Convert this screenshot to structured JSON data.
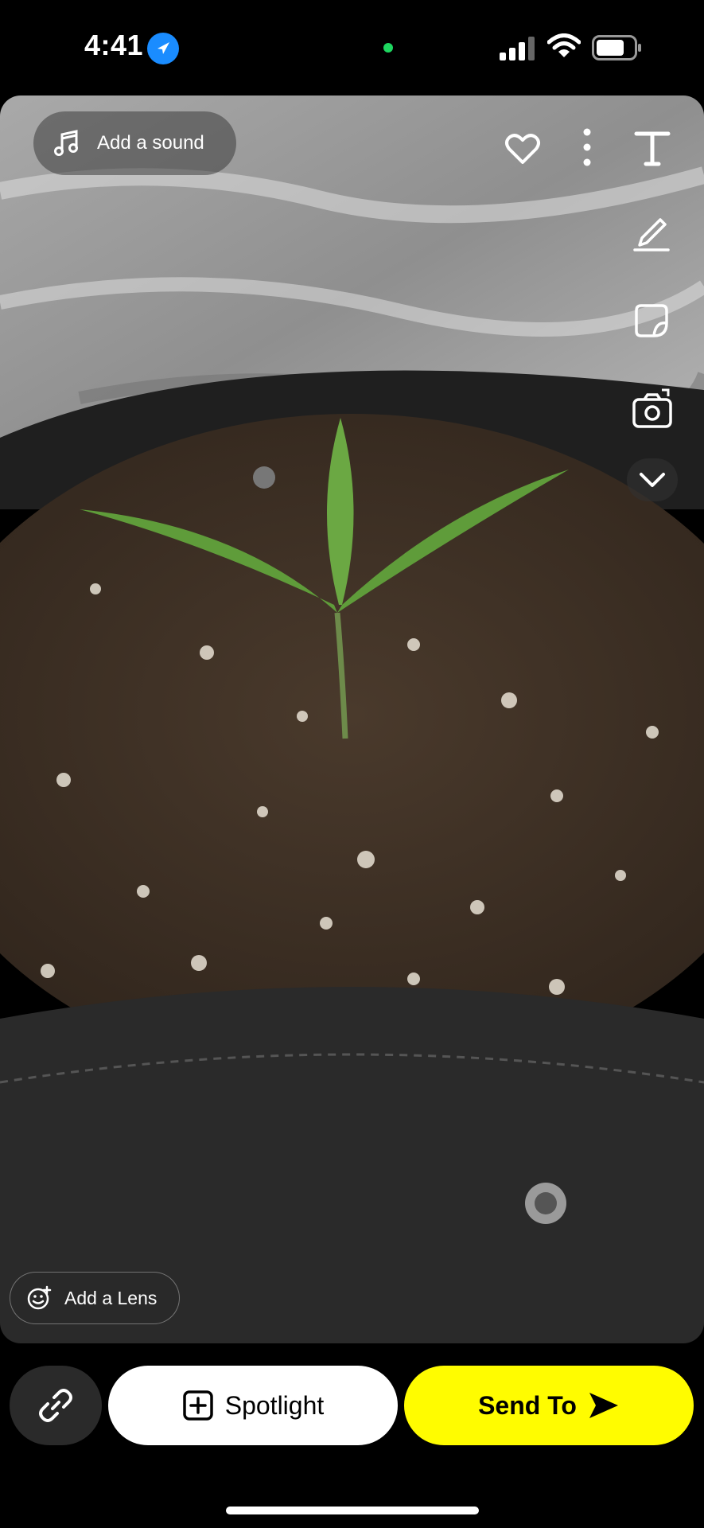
{
  "status_bar": {
    "time": "4:41"
  },
  "toolbar": {
    "add_sound_label": "Add a sound",
    "add_lens_label": "Add a Lens"
  },
  "actions": {
    "spotlight_label": "Spotlight",
    "send_to_label": "Send To"
  },
  "colors": {
    "send_button": "#fffc00",
    "location_icon": "#1a8cff",
    "mic_indicator": "#1ed760"
  },
  "icons": [
    "location-arrow-icon",
    "signal-icon",
    "wifi-icon",
    "battery-icon",
    "music-note-icon",
    "heart-icon",
    "more-vertical-icon",
    "text-icon",
    "pencil-icon",
    "sticker-icon",
    "camera-flip-icon",
    "chevron-down-icon",
    "lens-smile-icon",
    "link-icon",
    "plus-square-icon",
    "send-arrow-icon"
  ]
}
